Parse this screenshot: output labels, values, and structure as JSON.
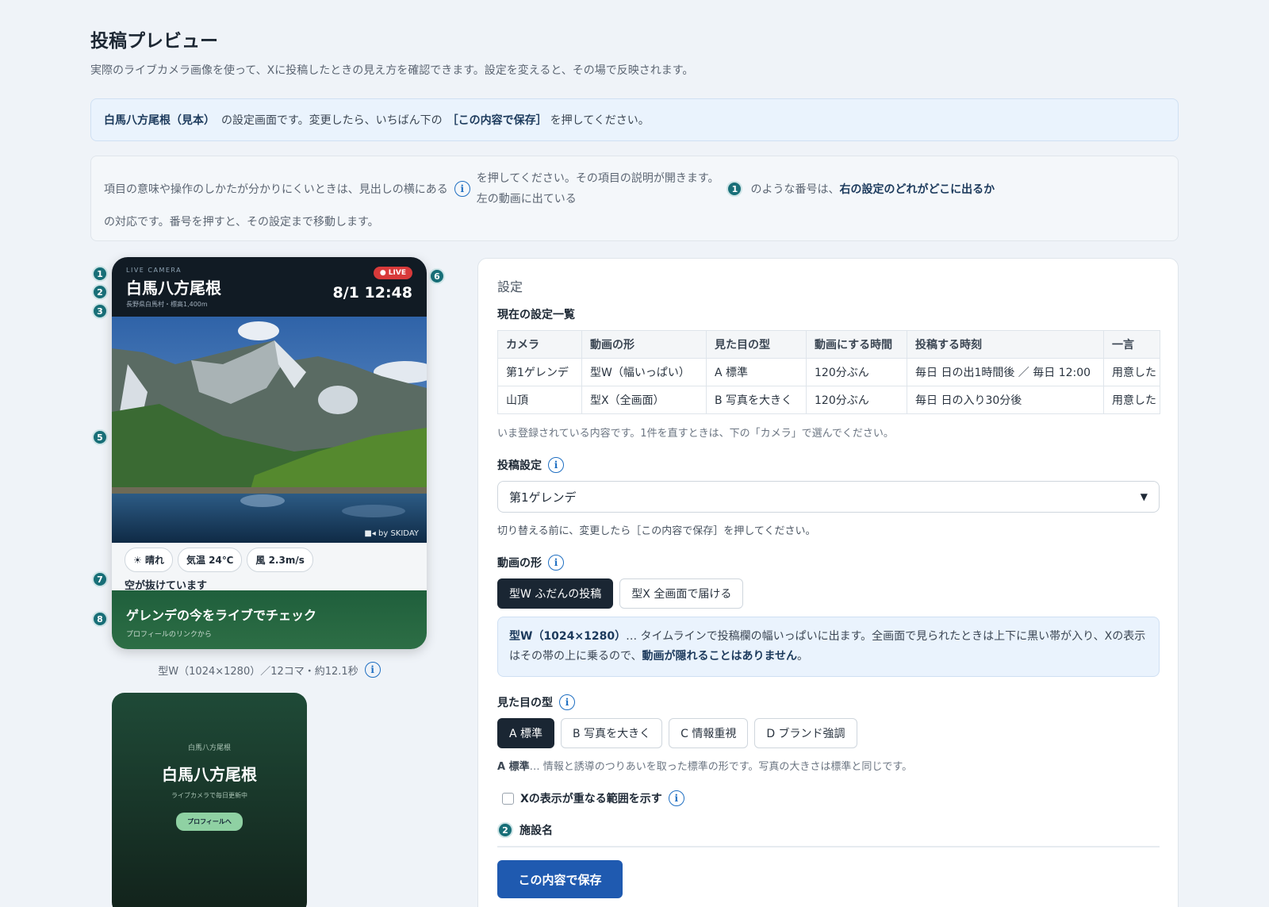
{
  "header": {
    "title": "投稿プレビュー",
    "subtitle": "実際のライブカメラ画像を使って、Xに投稿したときの見え方を確認できます。設定を変えると、その場で反映されます。"
  },
  "notice": {
    "facility": "白馬八方尾根（見本）",
    "middle": "の設定画面です。変更したら、いちばん下の",
    "save_ref": "［この内容で保存］",
    "end": "を押してください。"
  },
  "help": {
    "part1": "項目の意味や操作のしかたが分かりにくいときは、見出しの横にある",
    "part2a": "を押してください。その項目の説明が開きます。",
    "part2b": "左の動画に出ている",
    "part3": "のような番号は、",
    "strong": "右の設定のどれがどこに出るか",
    "part4": "の対応です。番号を押すと、その設定まで移動します。",
    "marker": "1"
  },
  "preview": {
    "kicker": "LIVE CAMERA",
    "title": "白馬八方尾根",
    "location": "長野県白馬村・標高1,400m",
    "live": "● LIVE",
    "time": "8/1 12:48",
    "credit": "by SKIDAY",
    "weather": "晴れ",
    "temp": "気温 24℃",
    "wind": "風 2.3m/s",
    "comment": "空が抜けています",
    "cta_title": "ゲレンデの今をライブでチェック",
    "cta_sub": "プロフィールのリンクから",
    "caption": "型W（1024×1280）／12コマ・約12.1秒",
    "markers": [
      "1",
      "2",
      "3",
      "5",
      "6",
      "7",
      "8"
    ]
  },
  "end_card": {
    "kicker": "白馬八方尾根",
    "title": "白馬八方尾根",
    "sub": "ライブカメラで毎日更新中",
    "button": "プロフィールへ"
  },
  "settings": {
    "title": "設定",
    "list_title": "現在の設定一覧",
    "columns": [
      "カメラ",
      "動画の形",
      "見た目の型",
      "動画にする時間",
      "投稿する時刻",
      "一言"
    ],
    "rows": [
      [
        "第1ゲレンデ",
        "型W（幅いっぱい）",
        "A 標準",
        "120分ぶん",
        "毎日 日の出1時間後 ／ 毎日 12:00",
        "用意した"
      ],
      [
        "山頂",
        "型X（全画面）",
        "B 写真を大きく",
        "120分ぶん",
        "毎日 日の入り30分後",
        "用意した"
      ]
    ],
    "list_note": "いま登録されている内容です。1件を直すときは、下の「カメラ」で選んでください。",
    "post_label": "投稿設定",
    "post_value": "第1ゲレンデ",
    "post_note": "切り替える前に、変更したら［この内容で保存］を押してください。",
    "shape_label": "動画の形",
    "shape_options": [
      "型W ふだんの投稿",
      "型X 全画面で届ける"
    ],
    "shape_desc_b": "型W（1024×1280）",
    "shape_desc": "… タイムラインで投稿欄の幅いっぱいに出ます。全画面で見られたときは上下に黒い帯が入り、Xの表示はその帯の上に乗るので、",
    "shape_desc_strong": "動画が隠れることはありません",
    "shape_desc_end": "。",
    "style_label": "見た目の型",
    "style_options": [
      "A 標準",
      "B 写真を大きく",
      "C 情報重視",
      "D ブランド強調"
    ],
    "style_note_b": "A 標準",
    "style_note": "… 情報と誘導のつりあいを取った標準の形です。写真の大きさは標準と同じです。",
    "overlay_label": "Xの表示が重なる範囲を示す",
    "facility_marker": "2",
    "facility_label": "施設名",
    "save": "この内容で保存"
  },
  "colors": {
    "accent": "#1f5ab0",
    "marker": "#186f78",
    "dark": "#1a2633"
  }
}
